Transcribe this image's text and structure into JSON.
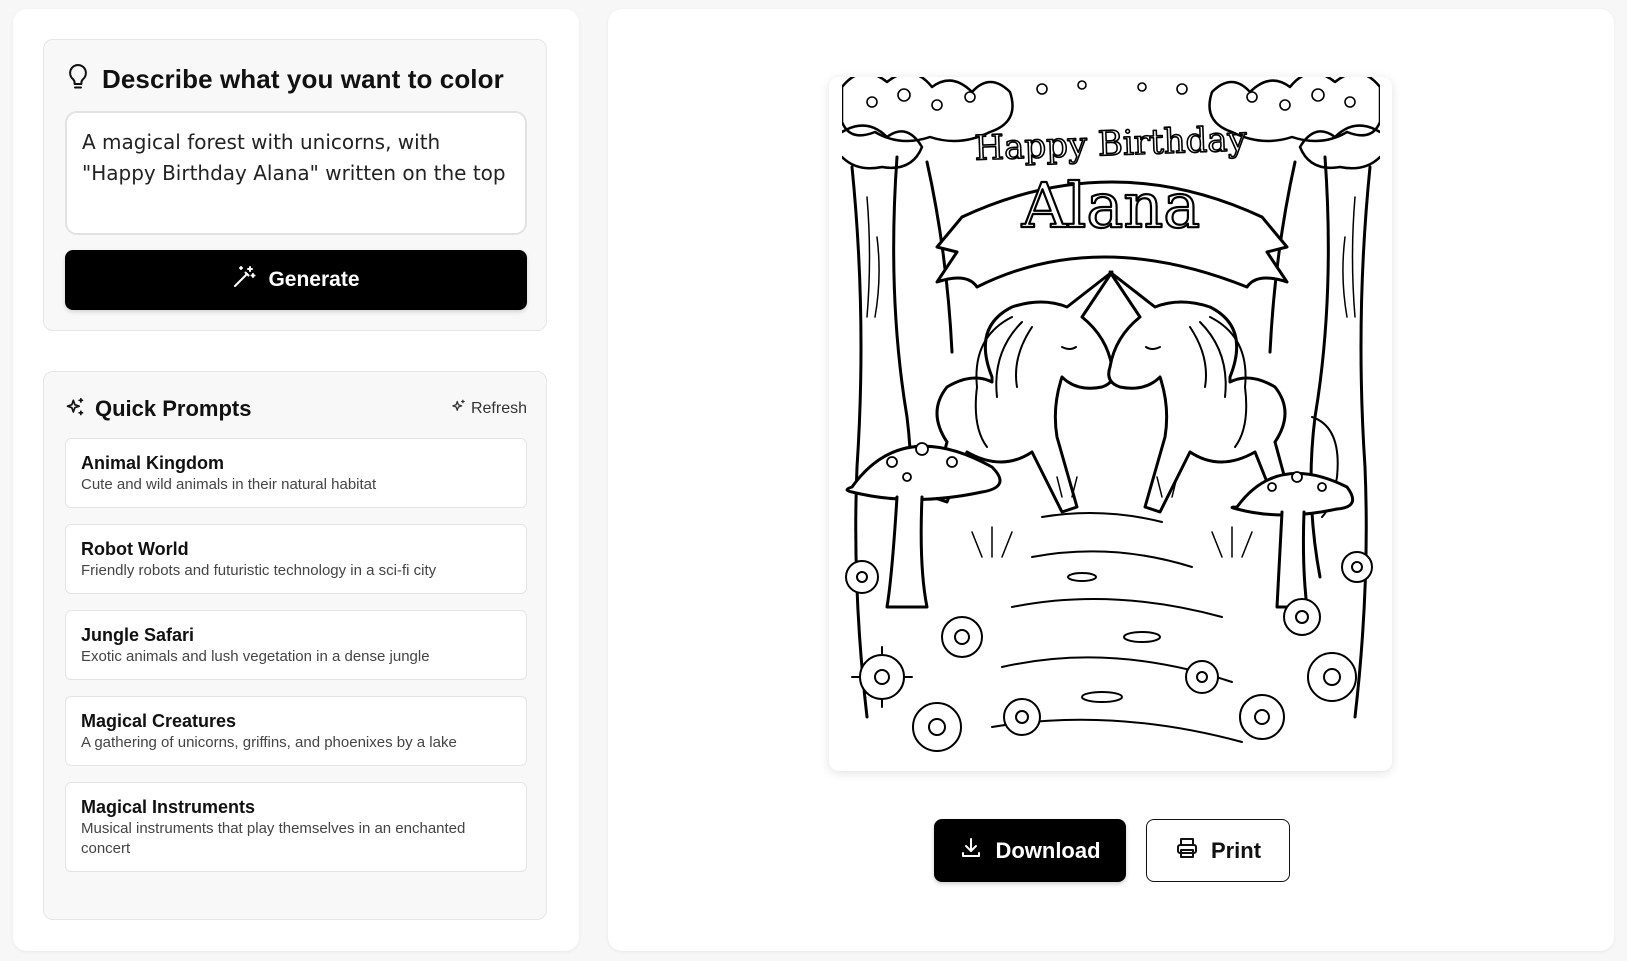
{
  "describe": {
    "title": "Describe what you want to color",
    "prompt_value": "A magical forest with unicorns, with \"Happy Birthday Alana\" written on the top",
    "generate_label": "Generate",
    "icon": "lightbulb-icon"
  },
  "quick_prompts": {
    "title": "Quick Prompts",
    "refresh_label": "Refresh",
    "items": [
      {
        "title": "Animal Kingdom",
        "description": "Cute and wild animals in their natural habitat"
      },
      {
        "title": "Robot World",
        "description": "Friendly robots and futuristic technology in a sci-fi city"
      },
      {
        "title": "Jungle Safari",
        "description": "Exotic animals and lush vegetation in a dense jungle"
      },
      {
        "title": "Magical Creatures",
        "description": "A gathering of unicorns, griffins, and phoenixes by a lake"
      },
      {
        "title": "Magical Instruments",
        "description": "Musical instruments that play themselves in an enchanted concert"
      }
    ]
  },
  "preview": {
    "banner_line1": "Happy Birthday",
    "banner_line2": "Alana",
    "download_label": "Download",
    "print_label": "Print"
  },
  "colors": {
    "primary": "#000000",
    "background": "#f7f7f7",
    "card": "#f8f8f8"
  }
}
